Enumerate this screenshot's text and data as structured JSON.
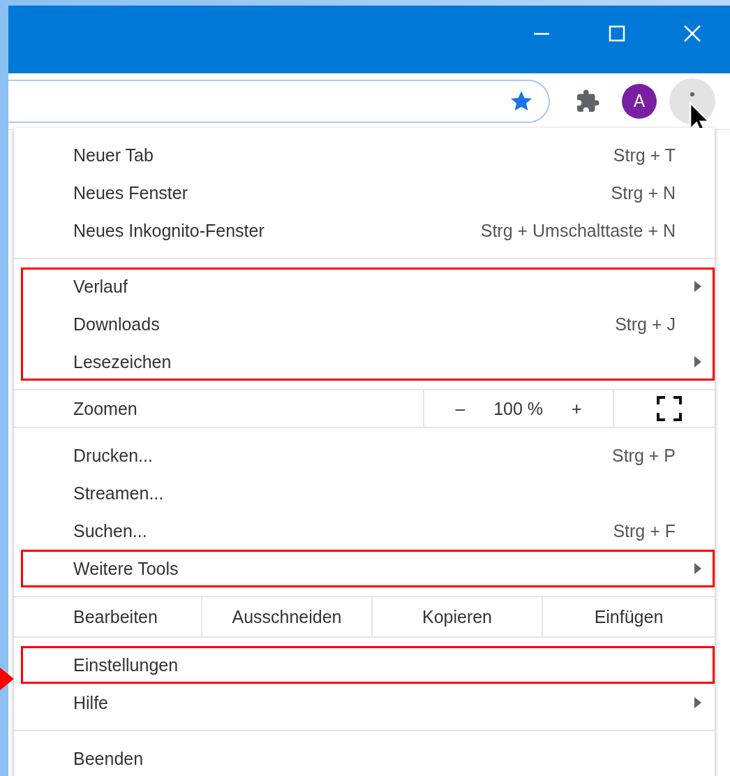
{
  "toolbar": {
    "avatar_letter": "A",
    "menu_button_active": true
  },
  "menu": {
    "sections": [
      {
        "kind": "items",
        "blocks": [
          {
            "highlighted": false,
            "pointer": false,
            "items": [
              {
                "label": "Neuer Tab",
                "shortcut": "Strg + T",
                "submenu": false
              },
              {
                "label": "Neues Fenster",
                "shortcut": "Strg + N",
                "submenu": false
              },
              {
                "label": "Neues Inkognito-Fenster",
                "shortcut": "Strg + Umschalttaste + N",
                "submenu": false
              }
            ]
          }
        ]
      },
      {
        "kind": "items",
        "blocks": [
          {
            "highlighted": true,
            "pointer": false,
            "items": [
              {
                "label": "Verlauf",
                "submenu": true
              },
              {
                "label": "Downloads",
                "shortcut": "Strg + J",
                "submenu": false
              },
              {
                "label": "Lesezeichen",
                "submenu": true
              }
            ]
          }
        ]
      },
      {
        "kind": "zoom",
        "label": "Zoomen",
        "minus": "–",
        "value": "100 %",
        "plus": "+"
      },
      {
        "kind": "items",
        "blocks": [
          {
            "highlighted": false,
            "pointer": false,
            "items": [
              {
                "label": "Drucken...",
                "shortcut": "Strg + P",
                "submenu": false
              },
              {
                "label": "Streamen...",
                "submenu": false
              },
              {
                "label": "Suchen...",
                "shortcut": "Strg + F",
                "submenu": false
              }
            ]
          },
          {
            "highlighted": true,
            "pointer": false,
            "items": [
              {
                "label": "Weitere Tools",
                "submenu": true
              }
            ]
          }
        ]
      },
      {
        "kind": "edit",
        "label": "Bearbeiten",
        "buttons": [
          "Ausschneiden",
          "Kopieren",
          "Einfügen"
        ]
      },
      {
        "kind": "items",
        "blocks": [
          {
            "highlighted": true,
            "pointer": true,
            "items": [
              {
                "label": "Einstellungen",
                "submenu": false
              }
            ]
          },
          {
            "highlighted": false,
            "pointer": false,
            "items": [
              {
                "label": "Hilfe",
                "submenu": true
              }
            ]
          }
        ]
      },
      {
        "kind": "items",
        "blocks": [
          {
            "highlighted": false,
            "pointer": false,
            "items": [
              {
                "label": "Beenden",
                "submenu": false
              }
            ]
          }
        ]
      }
    ]
  }
}
